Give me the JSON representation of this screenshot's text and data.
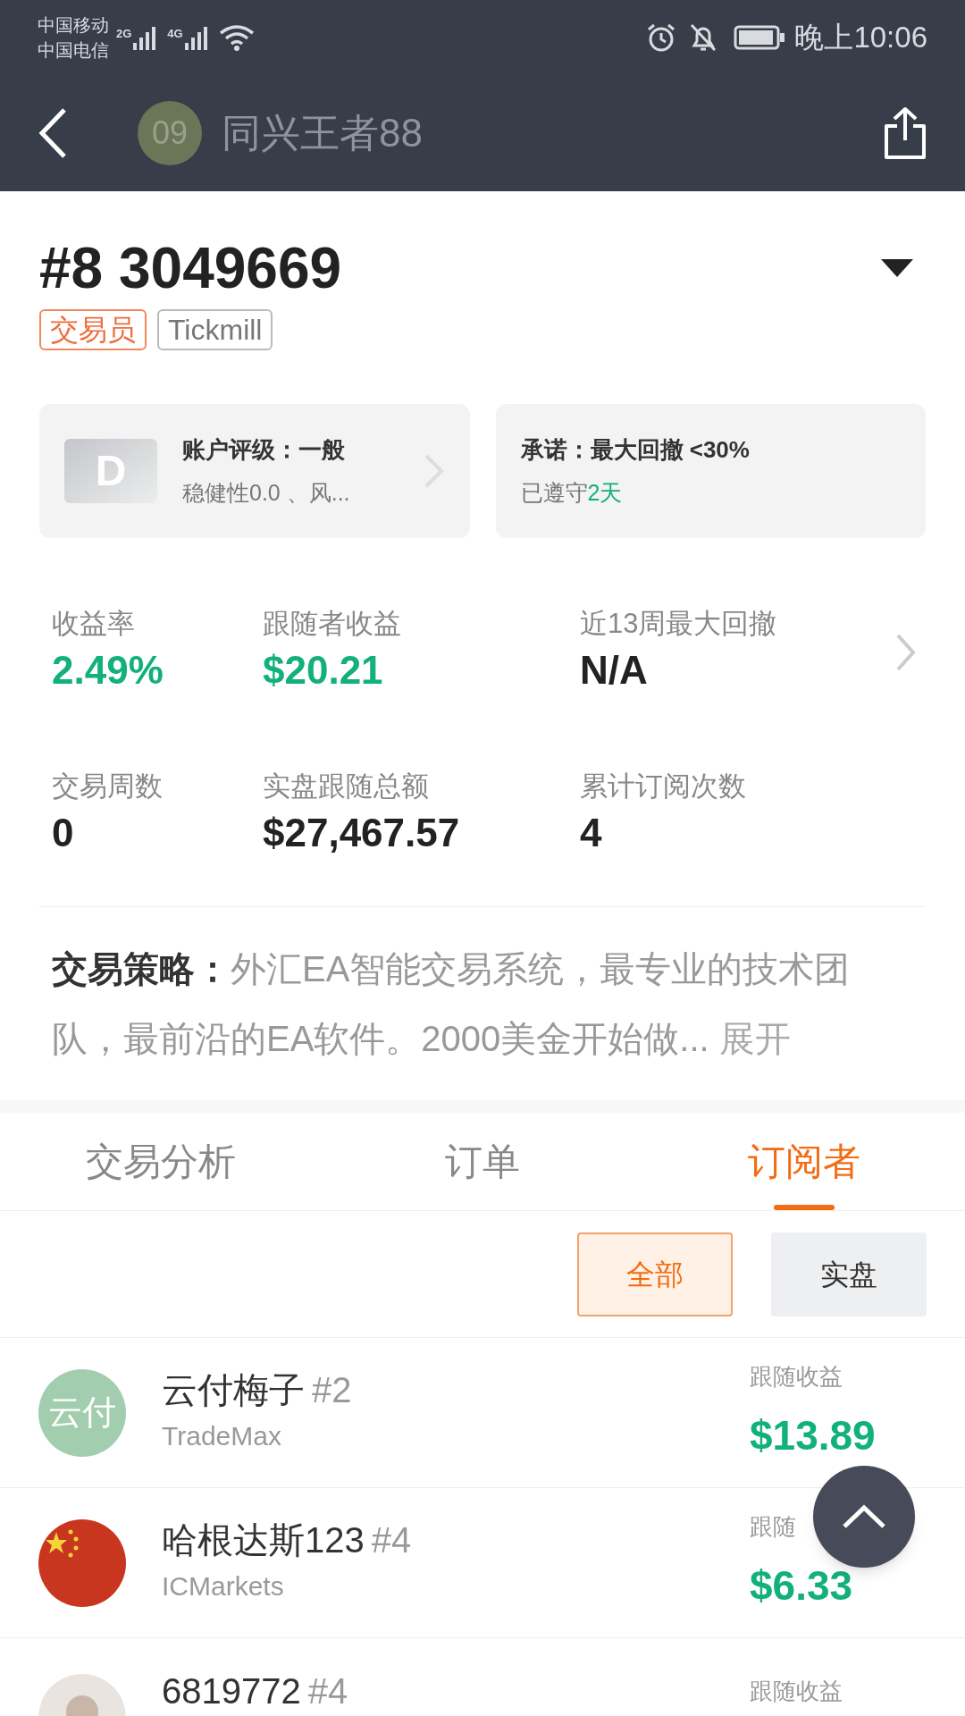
{
  "status_bar": {
    "carriers": [
      "中国移动",
      "中国电信"
    ],
    "network_1": "2G",
    "network_2": "4G",
    "time": "晚上10:06"
  },
  "header": {
    "avatar_text": "09",
    "title": "同兴王者88"
  },
  "account": {
    "title": "#8 3049669",
    "tags": [
      {
        "label": "交易员",
        "kind": "accent"
      },
      {
        "label": "Tickmill",
        "kind": "plain"
      }
    ]
  },
  "cards": [
    {
      "kind": "rating",
      "badge": "D",
      "title": "账户评级：一般",
      "subtitle": "稳健性0.0 、风..."
    },
    {
      "kind": "promise",
      "title": "承诺：最大回撤 <30%",
      "subtitle": "已遵守",
      "highlight": "2天"
    }
  ],
  "stats": [
    {
      "label": "收益率",
      "value": "2.49%",
      "positive": true
    },
    {
      "label": "跟随者收益",
      "value": "$20.21",
      "positive": true
    },
    {
      "label": "近13周最大回撤",
      "value": "N/A",
      "positive": false
    },
    {
      "label": "交易周数",
      "value": "0",
      "positive": false
    },
    {
      "label": "实盘跟随总额",
      "value": "$27,467.57",
      "positive": false
    },
    {
      "label": "累计订阅次数",
      "value": "4",
      "positive": false
    }
  ],
  "strategy": {
    "label": "交易策略：",
    "text": "外汇EA智能交易系统，最专业的技术团队，最前沿的EA软件。2000美金开始做...",
    "expand": "展开"
  },
  "tabs": [
    {
      "label": "交易分析",
      "selected": false
    },
    {
      "label": "订单",
      "selected": false
    },
    {
      "label": "订阅者",
      "selected": true
    }
  ],
  "filters": [
    {
      "label": "全部",
      "selected": true
    },
    {
      "label": "实盘",
      "selected": false
    }
  ],
  "subscribers": [
    {
      "kind": "text",
      "avatar_text": "云付",
      "name": "云付梅子",
      "rank": "#2",
      "broker": "TradeMax",
      "profit_label": "跟随收益",
      "profit": "$13.89"
    },
    {
      "kind": "flag",
      "name": "哈根达斯123",
      "rank": "#4",
      "broker": "ICMarkets",
      "profit_label": "跟随",
      "profit": "$6.33"
    },
    {
      "kind": "person",
      "name": "6819772",
      "rank": "#4",
      "profit_label": "跟随收益"
    }
  ]
}
